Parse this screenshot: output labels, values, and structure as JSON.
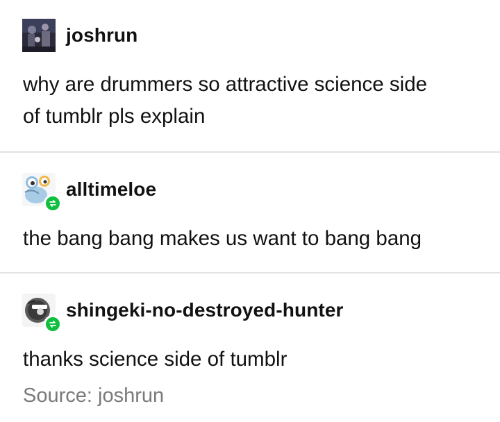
{
  "posts": [
    {
      "username": "joshrun",
      "reblog": false,
      "lines": [
        "why are drummers so attractive science side",
        "of tumblr pls explain"
      ]
    },
    {
      "username": "alltimeloe",
      "reblog": true,
      "lines": [
        "the bang bang makes us want to bang bang"
      ]
    },
    {
      "username": "shingeki-no-destroyed-hunter",
      "reblog": true,
      "lines": [
        "thanks science side of tumblr"
      ]
    }
  ],
  "source": {
    "label": "Source: joshrun"
  },
  "colors": {
    "reblog_badge": "#0fbf3f",
    "divider": "#e2e2e2",
    "source_text": "#7a7a7a",
    "text": "#111111"
  }
}
